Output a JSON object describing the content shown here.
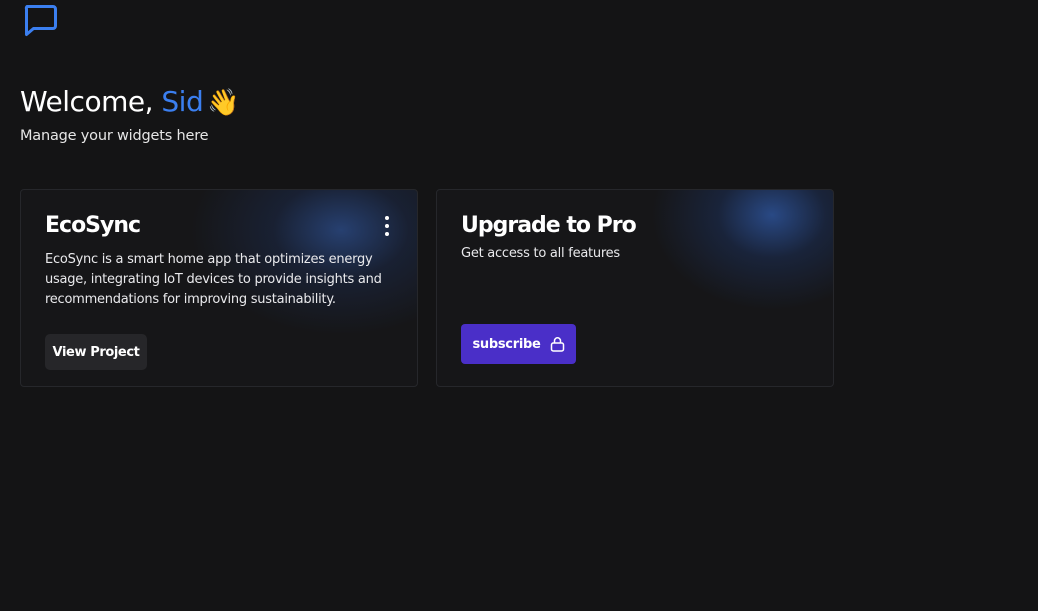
{
  "header": {
    "logo_icon": "chat-bubble-icon",
    "accent_color": "#3b7ff0"
  },
  "greeting": {
    "prefix": "Welcome, ",
    "name": "Sid",
    "emoji": "👋",
    "subtitle": "Manage your widgets here"
  },
  "cards": {
    "project": {
      "title": "EcoSync",
      "description": "EcoSync is a smart home app that optimizes energy usage, integrating IoT devices to provide insights and recommendations for improving sustainability.",
      "menu_icon": "more-vertical-icon",
      "button_label": "View Project"
    },
    "upgrade": {
      "title": "Upgrade to Pro",
      "description": "Get access to all features",
      "button_label": "subscribe",
      "button_icon": "lock-icon",
      "button_color": "#4a2fc8"
    }
  }
}
